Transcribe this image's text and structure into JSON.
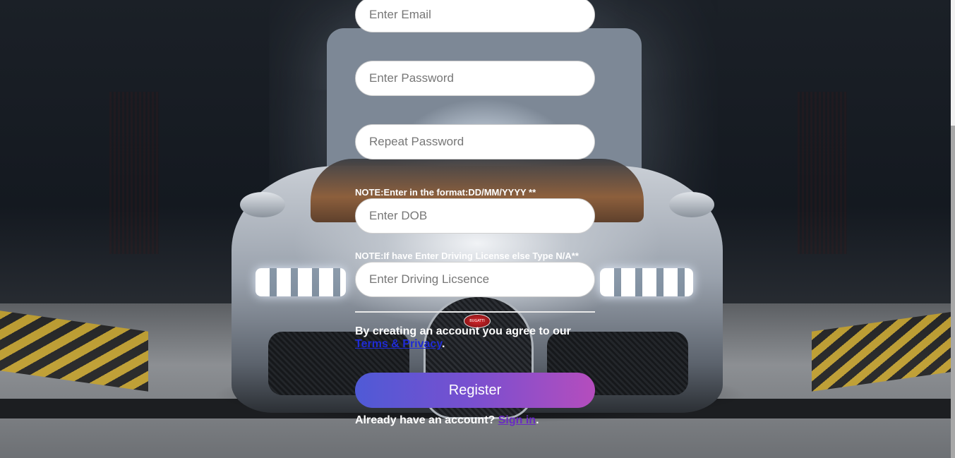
{
  "form": {
    "email_placeholder": "Enter Email",
    "password_placeholder": "Enter Password",
    "repeat_password_placeholder": "Repeat Password",
    "dob_note": "NOTE:Enter in the format:DD/MM/YYYY **",
    "dob_placeholder": "Enter DOB",
    "license_note": "NOTE:If have Enter Driving License else Type N/A**",
    "license_placeholder": "Enter Driving Licsence",
    "terms_text": "By creating an account you agree to our ",
    "terms_link": "Terms & Privacy",
    "terms_end": ".",
    "register_label": "Register",
    "signin_text": "Already have an account? ",
    "signin_link": "Sign in",
    "signin_end": "."
  },
  "background": {
    "badge_text": "BUGATTI"
  },
  "colors": {
    "button_gradient_start": "#4f5ad6",
    "button_gradient_end": "#b54dbd",
    "terms_link": "#1f2bd6",
    "signin_link": "#6a2bc4"
  }
}
